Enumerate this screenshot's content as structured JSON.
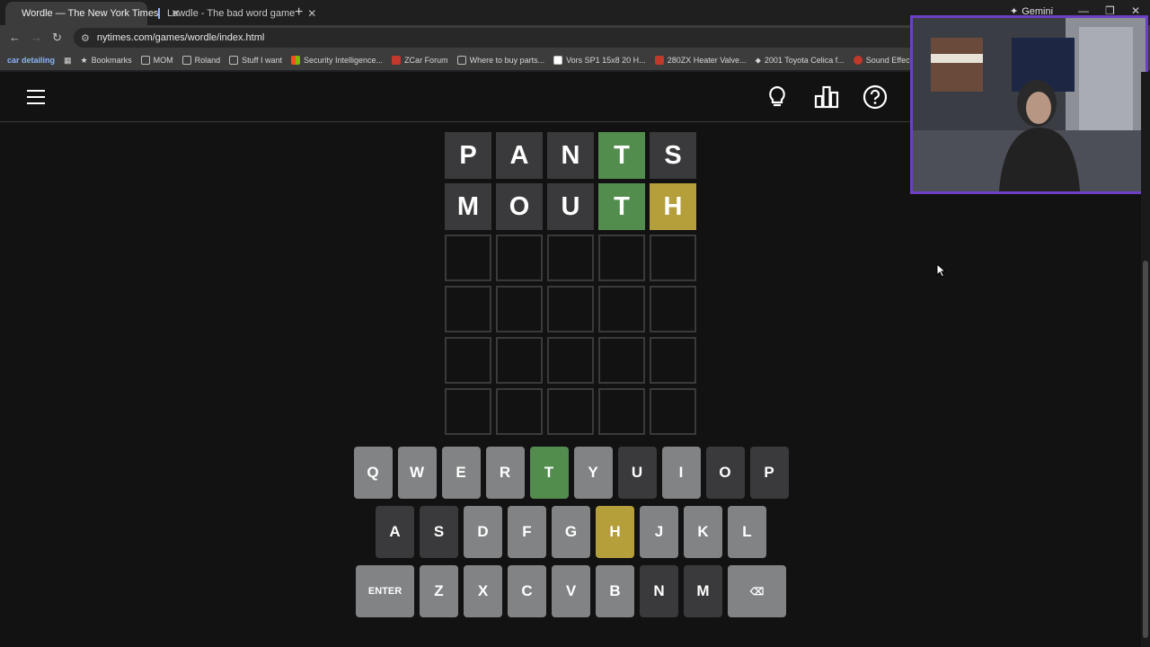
{
  "browser": {
    "tabs": [
      {
        "title": "Wordle — The New York Times",
        "active": true
      },
      {
        "title": "Lewdle - The bad word game",
        "active": false
      }
    ],
    "gemini_label": "Gemini",
    "url": "nytimes.com/games/wordle/index.html",
    "bookmarks": [
      "car detailing",
      "Bookmarks",
      "MOM",
      "Roland",
      "Stuff I want",
      "Security Intelligence...",
      "ZCar Forum",
      "Where to buy parts...",
      "Vors SP1 15x8 20 H...",
      "280ZX Heater Valve...",
      "2001 Toyota Celica f...",
      "Sound Effects Soun..."
    ]
  },
  "board": {
    "rows": [
      [
        {
          "l": "P",
          "s": "absent"
        },
        {
          "l": "A",
          "s": "absent"
        },
        {
          "l": "N",
          "s": "absent"
        },
        {
          "l": "T",
          "s": "correct"
        },
        {
          "l": "S",
          "s": "absent"
        }
      ],
      [
        {
          "l": "M",
          "s": "absent"
        },
        {
          "l": "O",
          "s": "absent"
        },
        {
          "l": "U",
          "s": "absent"
        },
        {
          "l": "T",
          "s": "correct"
        },
        {
          "l": "H",
          "s": "present"
        }
      ],
      [
        {
          "l": "",
          "s": "empty"
        },
        {
          "l": "",
          "s": "empty"
        },
        {
          "l": "",
          "s": "empty"
        },
        {
          "l": "",
          "s": "empty"
        },
        {
          "l": "",
          "s": "empty"
        }
      ],
      [
        {
          "l": "",
          "s": "empty"
        },
        {
          "l": "",
          "s": "empty"
        },
        {
          "l": "",
          "s": "empty"
        },
        {
          "l": "",
          "s": "empty"
        },
        {
          "l": "",
          "s": "empty"
        }
      ],
      [
        {
          "l": "",
          "s": "empty"
        },
        {
          "l": "",
          "s": "empty"
        },
        {
          "l": "",
          "s": "empty"
        },
        {
          "l": "",
          "s": "empty"
        },
        {
          "l": "",
          "s": "empty"
        }
      ],
      [
        {
          "l": "",
          "s": "empty"
        },
        {
          "l": "",
          "s": "empty"
        },
        {
          "l": "",
          "s": "empty"
        },
        {
          "l": "",
          "s": "empty"
        },
        {
          "l": "",
          "s": "empty"
        }
      ]
    ]
  },
  "keyboard": {
    "rows": [
      [
        {
          "k": "Q",
          "s": "unused"
        },
        {
          "k": "W",
          "s": "unused"
        },
        {
          "k": "E",
          "s": "unused"
        },
        {
          "k": "R",
          "s": "unused"
        },
        {
          "k": "T",
          "s": "correct"
        },
        {
          "k": "Y",
          "s": "unused"
        },
        {
          "k": "U",
          "s": "absent"
        },
        {
          "k": "I",
          "s": "unused"
        },
        {
          "k": "O",
          "s": "absent"
        },
        {
          "k": "P",
          "s": "absent"
        }
      ],
      [
        {
          "k": "A",
          "s": "absent"
        },
        {
          "k": "S",
          "s": "absent"
        },
        {
          "k": "D",
          "s": "unused"
        },
        {
          "k": "F",
          "s": "unused"
        },
        {
          "k": "G",
          "s": "unused"
        },
        {
          "k": "H",
          "s": "present"
        },
        {
          "k": "J",
          "s": "unused"
        },
        {
          "k": "K",
          "s": "unused"
        },
        {
          "k": "L",
          "s": "unused"
        }
      ],
      [
        {
          "k": "ENTER",
          "s": "wide"
        },
        {
          "k": "Z",
          "s": "unused"
        },
        {
          "k": "X",
          "s": "unused"
        },
        {
          "k": "C",
          "s": "unused"
        },
        {
          "k": "V",
          "s": "unused"
        },
        {
          "k": "B",
          "s": "unused"
        },
        {
          "k": "N",
          "s": "absent"
        },
        {
          "k": "M",
          "s": "absent"
        },
        {
          "k": "⌫",
          "s": "wide"
        }
      ]
    ]
  },
  "colors": {
    "correct": "#538d4e",
    "present": "#b59f3b",
    "absent": "#3a3a3c",
    "unused": "#818384",
    "webcam_border": "#6c3fc4"
  },
  "icons": {
    "menu": "hamburger-icon",
    "hint": "lightbulb-icon",
    "stats": "bar-chart-icon",
    "help": "question-icon"
  }
}
